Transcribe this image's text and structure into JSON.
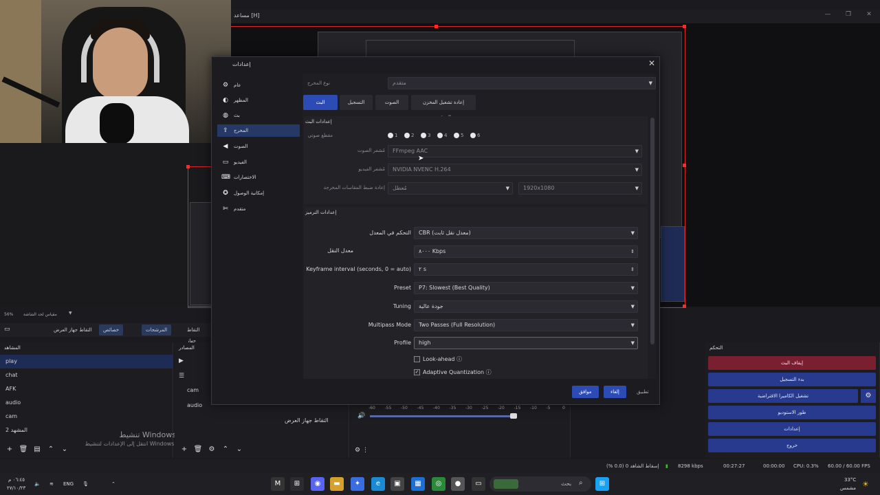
{
  "window": {
    "title": "مساعد [H]",
    "controls": [
      "—",
      "❐",
      "✕"
    ]
  },
  "zoom": {
    "percent": "56%",
    "label": "مقياس لحد الشاشة"
  },
  "dock_tabs": [
    {
      "label": "التقاط جهاز العرض"
    },
    {
      "label": "خصائص"
    },
    {
      "label": "المرشحات"
    },
    {
      "label": "التقاط جهاز العرض"
    }
  ],
  "scenes": {
    "header": "المشاهد",
    "items": [
      "play",
      "chat",
      "AFK",
      "audio",
      "cam",
      "المشهد 2"
    ]
  },
  "sources": {
    "header": "المصادر",
    "items": [
      "cam",
      "audio",
      "التقاط جهاز العرض"
    ]
  },
  "mixer": {
    "scale": [
      "-60",
      "-55",
      "-50",
      "-45",
      "-40",
      "-35",
      "-30",
      "-25",
      "-20",
      "-15",
      "-10",
      "-5",
      "0"
    ]
  },
  "controls_dock": {
    "header": "التحكم",
    "buttons": [
      "إيقاف البث",
      "بدء التسجيل",
      "تشغيل الكاميرا الافتراضية",
      "طور الاستوديو",
      "إعدادات",
      "خروج"
    ]
  },
  "status": {
    "dropped": "إسقاط الشاهد 0 (0.0 %)",
    "bitrate": "8298 kbps",
    "stream_time": "00:27:27",
    "rec_time": "00:00:00",
    "cpu": "CPU: 0.3%",
    "fps": "60.00 / 60.00 FPS"
  },
  "watermark": {
    "line1": "تنشيط Windows",
    "line2": "انتقل إلى الإعدادات لتنشيط Windows."
  },
  "taskbar": {
    "time": "٠٦:٤٥ م",
    "date": "٢٧/١٠/٢٣",
    "lang": "ENG",
    "search_placeholder": "بحث",
    "weather_temp": "33°C",
    "weather_desc": "مشمس"
  },
  "dialog": {
    "title": "إعدادات",
    "sidebar": [
      {
        "label": "عام",
        "icon": "gear-icon"
      },
      {
        "label": "المظهر",
        "icon": "palette-icon"
      },
      {
        "label": "بث",
        "icon": "globe-icon"
      },
      {
        "label": "المخرج",
        "icon": "output-icon"
      },
      {
        "label": "الصوت",
        "icon": "speaker-icon"
      },
      {
        "label": "الفيديو",
        "icon": "monitor-icon"
      },
      {
        "label": "الاختصارات",
        "icon": "keyboard-icon"
      },
      {
        "label": "إمكانية الوصول",
        "icon": "accessibility-icon"
      },
      {
        "label": "متقدم",
        "icon": "wrench-icon"
      }
    ],
    "output_mode_label": "نوع المخرج",
    "output_mode_value": "متقدم",
    "tabs": [
      "البث",
      "التسجيل",
      "الصوت",
      "إعادة تشغيل المخزن المؤقت"
    ],
    "stream_section": "إعدادات البث",
    "audio_track_label": "مقطع صوتي",
    "tracks": [
      "1",
      "2",
      "3",
      "4",
      "5",
      "6"
    ],
    "audio_encoder_label": "مُشفر الصوت",
    "audio_encoder_value": "FFmpeg AAC",
    "video_encoder_label": "مُشفر الفيديو",
    "video_encoder_value": "NVIDIA NVENC H.264",
    "rescale_label": "إعادة ضبط المقاسات المخرجة",
    "rescale_value": "مُعطل",
    "rescale_res": "1920x1080",
    "encoder_section": "إعدادات الترميز",
    "rate_control_label": "التحكم في المعدل",
    "rate_control_value": "CBR (معدل نقل ثابت)",
    "bitrate_label": "معدل النقل",
    "bitrate_value": "٨٠٠٠ Kbps",
    "keyframe_label": "Keyframe interval (seconds, 0 = auto)",
    "keyframe_value": "٢ s",
    "preset_label": "Preset",
    "preset_value": "P7: Slowest (Best Quality)",
    "tuning_label": "Tuning",
    "tuning_value": "جودة عالية",
    "multipass_label": "Multipass Mode",
    "multipass_value": "Two Passes (Full Resolution)",
    "profile_label": "Profile",
    "profile_value": "high",
    "lookahead_label": "Look-ahead",
    "adaptive_label": "Adaptive Quantization",
    "buttons": {
      "ok": "موافق",
      "cancel": "إلغاء",
      "apply": "تطبيق"
    }
  }
}
